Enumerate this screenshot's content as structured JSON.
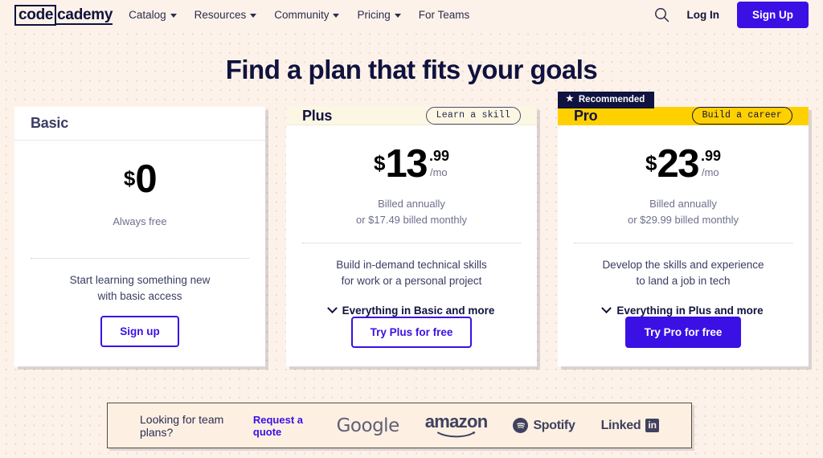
{
  "header": {
    "logo": {
      "boxed": "code",
      "rest": "cademy"
    },
    "nav": [
      {
        "label": "Catalog",
        "has_dropdown": true
      },
      {
        "label": "Resources",
        "has_dropdown": true
      },
      {
        "label": "Community",
        "has_dropdown": true
      },
      {
        "label": "Pricing",
        "has_dropdown": true
      },
      {
        "label": "For Teams",
        "has_dropdown": false
      }
    ],
    "search_icon": "search-icon",
    "login_label": "Log In",
    "signup_label": "Sign Up",
    "accent_color": "#3a10e5"
  },
  "headline": "Find a plan that fits your goals",
  "plans": [
    {
      "name": "Basic",
      "tag": null,
      "recommended_label": null,
      "currency": "$",
      "amount": "0",
      "cents": null,
      "per": null,
      "sub_line1": "Always free",
      "sub_line2": null,
      "desc_line1": "Start learning something new",
      "desc_line2": "with basic access",
      "everything": null,
      "cta_label": "Sign up",
      "cta_style": "outline"
    },
    {
      "name": "Plus",
      "tag": "Learn a skill",
      "recommended_label": null,
      "currency": "$",
      "amount": "13",
      "cents": ".99",
      "per": "/mo",
      "sub_line1": "Billed annually",
      "sub_line2": "or $17.49 billed monthly",
      "desc_line1": "Build in-demand technical skills",
      "desc_line2": "for work or a personal project",
      "everything": "Everything in Basic and more",
      "cta_label": "Try Plus for free",
      "cta_style": "outline"
    },
    {
      "name": "Pro",
      "tag": "Build a career",
      "recommended_label": "Recommended",
      "currency": "$",
      "amount": "23",
      "cents": ".99",
      "per": "/mo",
      "sub_line1": "Billed annually",
      "sub_line2": "or $29.99 billed monthly",
      "desc_line1": "Develop the skills and experience",
      "desc_line2": "to land a job in tech",
      "everything": "Everything in Plus and more",
      "cta_label": "Try Pro for free",
      "cta_style": "solid"
    }
  ],
  "team_bar": {
    "question": "Looking for team plans?",
    "link_label": "Request a quote",
    "logos": [
      {
        "name": "google",
        "text": "Google"
      },
      {
        "name": "amazon",
        "text": "amazon"
      },
      {
        "name": "spotify",
        "text": "Spotify"
      },
      {
        "name": "linkedin",
        "text": "Linked",
        "mark": "in"
      }
    ]
  }
}
